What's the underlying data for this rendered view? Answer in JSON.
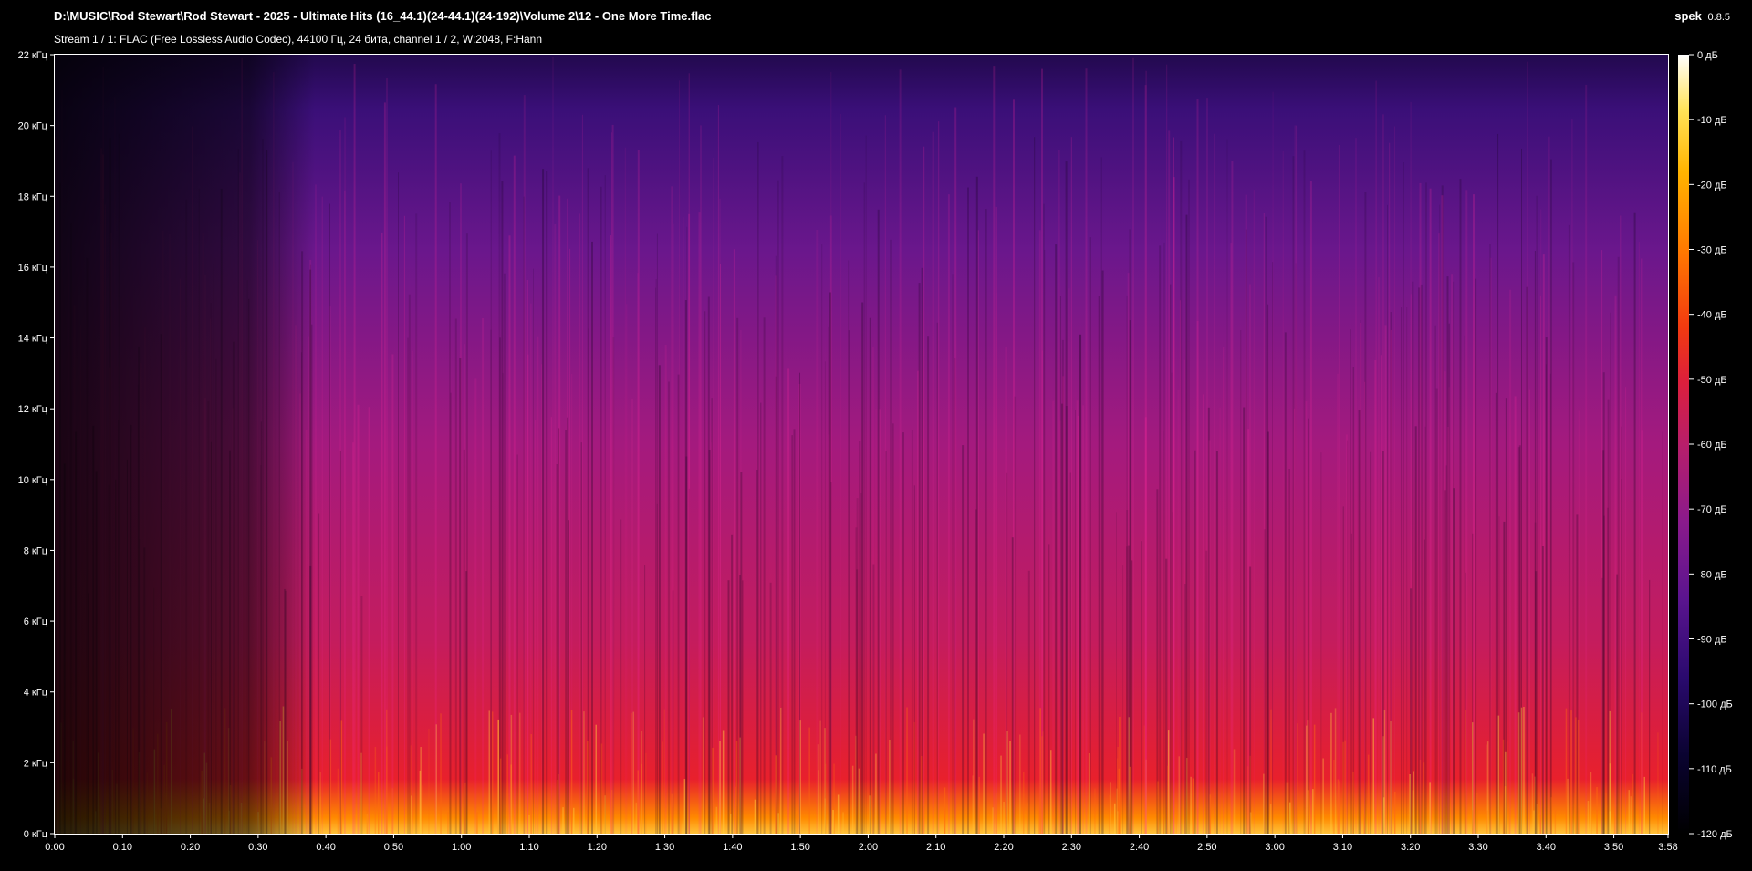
{
  "header": {
    "file_path": "D:\\MUSIC\\Rod Stewart\\Rod Stewart - 2025 - Ultimate Hits (16_44.1)(24-44.1)(24-192)\\Volume 2\\12 - One More Time.flac",
    "stream_info": "Stream 1 / 1: FLAC (Free Lossless Audio Codec), 44100 Гц, 24 бита, channel 1 / 2, W:2048, F:Hann",
    "app_name": "spek",
    "app_version": "0.8.5"
  },
  "spectrogram": {
    "freq_ticks": [
      "0 кГц",
      "2 кГц",
      "4 кГц",
      "6 кГц",
      "8 кГц",
      "10 кГц",
      "12 кГц",
      "14 кГц",
      "16 кГц",
      "18 кГц",
      "20 кГц",
      "22 кГц"
    ],
    "time_ticks": [
      "0:00",
      "0:10",
      "0:20",
      "0:30",
      "0:40",
      "0:50",
      "1:00",
      "1:10",
      "1:20",
      "1:30",
      "1:40",
      "1:50",
      "2:00",
      "2:10",
      "2:20",
      "2:30",
      "2:40",
      "2:50",
      "3:00",
      "3:10",
      "3:20",
      "3:30",
      "3:40",
      "3:50",
      "3:58"
    ],
    "db_ticks": [
      "0 дБ",
      "-10 дБ",
      "-20 дБ",
      "-30 дБ",
      "-40 дБ",
      "-50 дБ",
      "-60 дБ",
      "-70 дБ",
      "-80 дБ",
      "-90 дБ",
      "-100 дБ",
      "-110 дБ",
      "-120 дБ"
    ],
    "palette": [
      "#000000",
      "#0a0330",
      "#2a0a6e",
      "#5a148f",
      "#8a1a8c",
      "#b81e6a",
      "#dc1f3c",
      "#f23a10",
      "#ff7a00",
      "#ffb400",
      "#ffe45a",
      "#ffffff"
    ]
  }
}
